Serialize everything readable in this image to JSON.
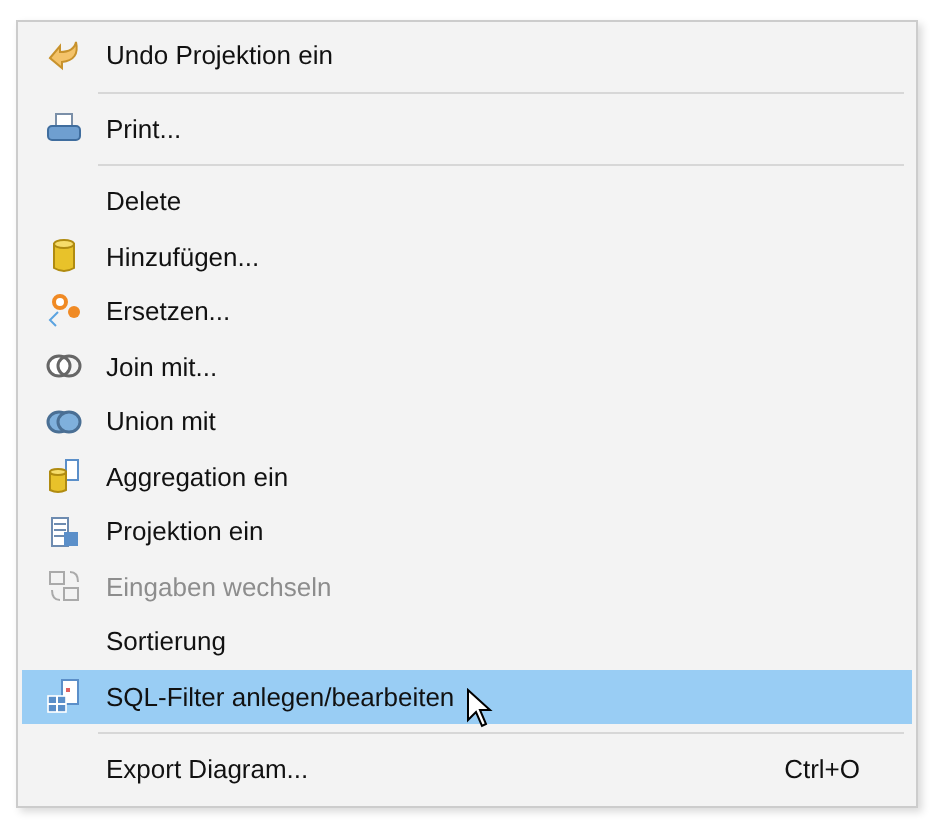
{
  "menu": {
    "items": [
      {
        "kind": "item",
        "label": "Undo Projektion ein",
        "disabled": false,
        "selected": false
      },
      {
        "kind": "separator"
      },
      {
        "kind": "item",
        "label": "Print...",
        "disabled": false,
        "selected": false
      },
      {
        "kind": "separator"
      },
      {
        "kind": "item",
        "label": "Delete",
        "disabled": false,
        "selected": false
      },
      {
        "kind": "item",
        "label": "Hinzufügen...",
        "disabled": false,
        "selected": false
      },
      {
        "kind": "item",
        "label": "Ersetzen...",
        "disabled": false,
        "selected": false
      },
      {
        "kind": "item",
        "label": "Join mit...",
        "disabled": false,
        "selected": false
      },
      {
        "kind": "item",
        "label": "Union mit",
        "disabled": false,
        "selected": false
      },
      {
        "kind": "item",
        "label": "Aggregation ein",
        "disabled": false,
        "selected": false
      },
      {
        "kind": "item",
        "label": "Projektion ein",
        "disabled": false,
        "selected": false
      },
      {
        "kind": "item",
        "label": "Eingaben wechseln",
        "disabled": true,
        "selected": false
      },
      {
        "kind": "item",
        "label": "Sortierung",
        "disabled": false,
        "selected": false
      },
      {
        "kind": "item",
        "label": "SQL-Filter anlegen/bearbeiten",
        "disabled": false,
        "selected": true
      },
      {
        "kind": "separator"
      },
      {
        "kind": "item",
        "label": "Export Diagram...",
        "shortcut": "Ctrl+O",
        "disabled": false,
        "selected": false
      }
    ]
  }
}
